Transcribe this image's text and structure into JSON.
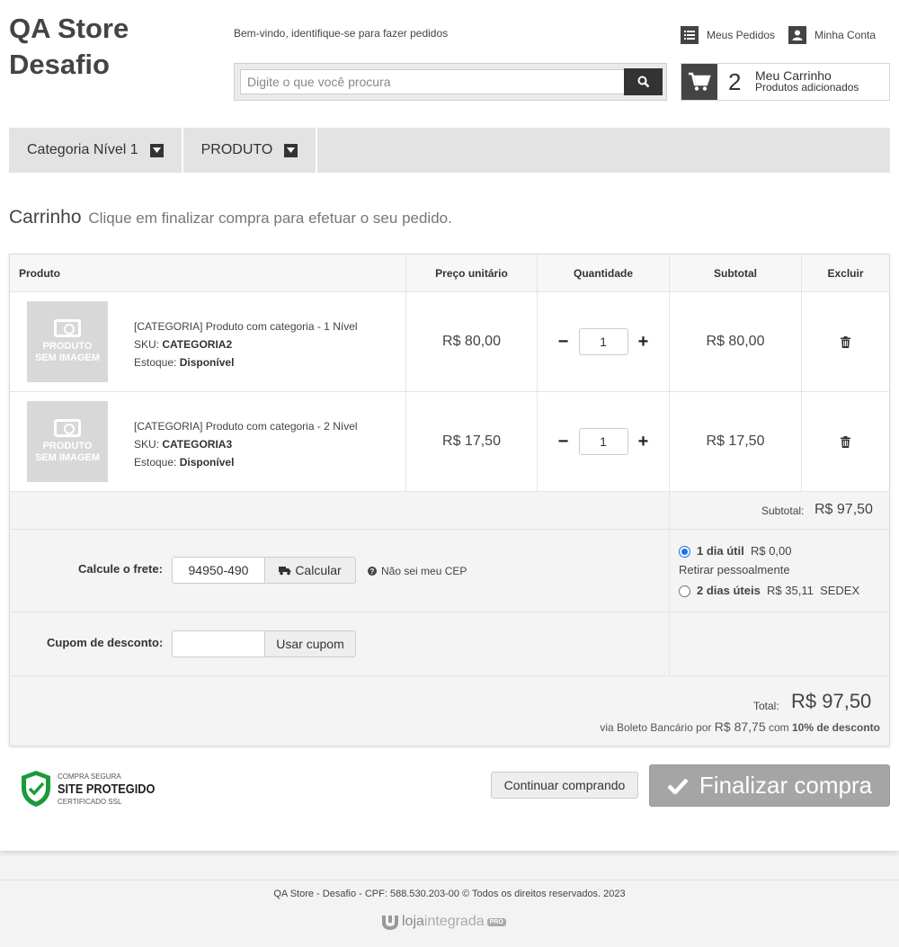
{
  "header": {
    "logo_line1": "QA Store",
    "logo_line2": "Desafio",
    "welcome": "Bem-vindo, identifique-se para fazer pedidos",
    "search_placeholder": "Digite o que você procura",
    "my_orders": "Meus Pedidos",
    "my_account": "Minha Conta",
    "cart_count": "2",
    "cart_title": "Meu Carrinho",
    "cart_subtitle": "Produtos adicionados"
  },
  "nav": {
    "items": [
      {
        "label": "Categoria Nível 1",
        "icon": "chevron-down-icon"
      },
      {
        "label": "PRODUTO",
        "icon": "chevron-down-icon"
      }
    ]
  },
  "page": {
    "title": "Carrinho",
    "subtitle": "Clique em finalizar compra para efetuar o seu pedido."
  },
  "table": {
    "headers": {
      "product": "Produto",
      "unit_price": "Preço unitário",
      "quantity": "Quantidade",
      "subtotal": "Subtotal",
      "remove": "Excluir"
    },
    "placeholder_image_line1": "PRODUTO",
    "placeholder_image_line2": "SEM IMAGEM",
    "sku_label": "SKU:",
    "stock_label": "Estoque:",
    "rows": [
      {
        "name": "[CATEGORIA] Produto com categoria - 1 Nível",
        "sku": "CATEGORIA2",
        "stock": "Disponível",
        "unit_price": "R$ 80,00",
        "quantity": "1",
        "subtotal": "R$ 80,00"
      },
      {
        "name": "[CATEGORIA] Produto com categoria - 2 Nível",
        "sku": "CATEGORIA3",
        "stock": "Disponível",
        "unit_price": "R$ 17,50",
        "quantity": "1",
        "subtotal": "R$ 17,50"
      }
    ]
  },
  "summary": {
    "subtotal_label": "Subtotal:",
    "subtotal_value": "R$ 97,50",
    "shipping_label": "Calcule o frete:",
    "cep_value": "94950-490",
    "calc_button": "Calcular",
    "no_cep": "Não sei meu CEP",
    "shipping_options": [
      {
        "days": "1 dia útil",
        "price": "R$ 0,00",
        "note": "Retirar pessoalmente",
        "selected": true
      },
      {
        "days": "2 dias úteis",
        "price": "R$ 35,11",
        "note": "SEDEX",
        "selected": false
      }
    ],
    "coupon_label": "Cupom de desconto:",
    "coupon_value": "",
    "coupon_button": "Usar cupom",
    "total_label": "Total:",
    "total_value": "R$ 97,50",
    "boleto_prefix": "via Boleto Bancário por",
    "boleto_value": "R$ 87,75",
    "boleto_with": "com",
    "boleto_discount": "10% de desconto"
  },
  "actions": {
    "seal_small_top": "COMPRA SEGURA",
    "seal_big": "SITE PROTEGIDO",
    "seal_small_bottom": "CERTIFICADO SSL",
    "continue": "Continuar comprando",
    "finish": "Finalizar compra"
  },
  "footer": {
    "text": "QA Store - Desafio - CPF: 588.530.203-00 © Todos os direitos reservados. 2023",
    "brand_a": "loja",
    "brand_b": "integrada",
    "brand_pro": "PRO"
  },
  "colors": {
    "dark": "#333333",
    "nav_bg": "#e3e3e3",
    "finish_button": "#a5a5a5",
    "radio_selected": "#1a73e8",
    "shield_green": "#1a9b3a"
  }
}
